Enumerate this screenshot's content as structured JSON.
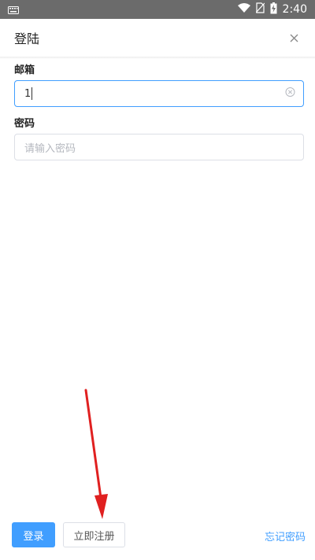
{
  "status_bar": {
    "time": "2:40",
    "icons": [
      "keyboard-icon",
      "wifi-icon",
      "no-sim-icon",
      "battery-charging-icon"
    ]
  },
  "header": {
    "title": "登陆",
    "close_icon": "close-icon"
  },
  "form": {
    "email": {
      "label": "邮箱",
      "value": "1",
      "clear_icon": "clear-circle-icon"
    },
    "password": {
      "label": "密码",
      "placeholder": "请输入密码"
    }
  },
  "footer": {
    "login_label": "登录",
    "register_label": "立即注册",
    "forgot_label": "忘记密码"
  },
  "colors": {
    "accent": "#409eff",
    "status_bar": "#6b6b6b",
    "annotation_arrow": "#e02020"
  }
}
